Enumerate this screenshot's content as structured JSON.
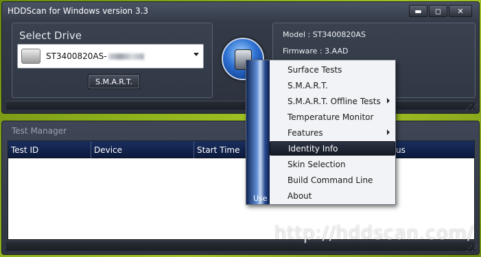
{
  "window": {
    "title": "HDDScan for Windows version 3.3",
    "controls": {
      "minimize": "▬",
      "maximize": "◻",
      "close": "✕"
    }
  },
  "drive_panel": {
    "label": "Select Drive",
    "selected_drive": "ST3400820AS-",
    "drive_icon": "hard-disk-icon",
    "smart_button": "S.M.A.R.T."
  },
  "info_panel": {
    "model": "Model : ST3400820AS",
    "firmware": "Firmware : 3.AAD"
  },
  "test_manager": {
    "title": "Test Manager",
    "columns": [
      "Test ID",
      "Device",
      "Start Time"
    ],
    "col4_tail": "us"
  },
  "context_menu": {
    "side_label": "Use",
    "items": [
      {
        "label": "Surface Tests",
        "submenu": false
      },
      {
        "label": "S.M.A.R.T.",
        "submenu": false
      },
      {
        "label": "S.M.A.R.T. Offline Tests",
        "submenu": true
      },
      {
        "label": "Temperature Monitor",
        "submenu": false
      },
      {
        "label": "Features",
        "submenu": true
      },
      {
        "label": "Identity Info",
        "submenu": false,
        "highlighted": true
      },
      {
        "label": "Skin Selection",
        "submenu": false
      },
      {
        "label": "Build Command Line",
        "submenu": false
      },
      {
        "label": "About",
        "submenu": false
      }
    ]
  },
  "watermark": "http://hddscan.com/",
  "colors": {
    "accent_blue": "#2c6fd0",
    "header_navy": "#1a2e5e",
    "background_green": "#8fb31c"
  }
}
